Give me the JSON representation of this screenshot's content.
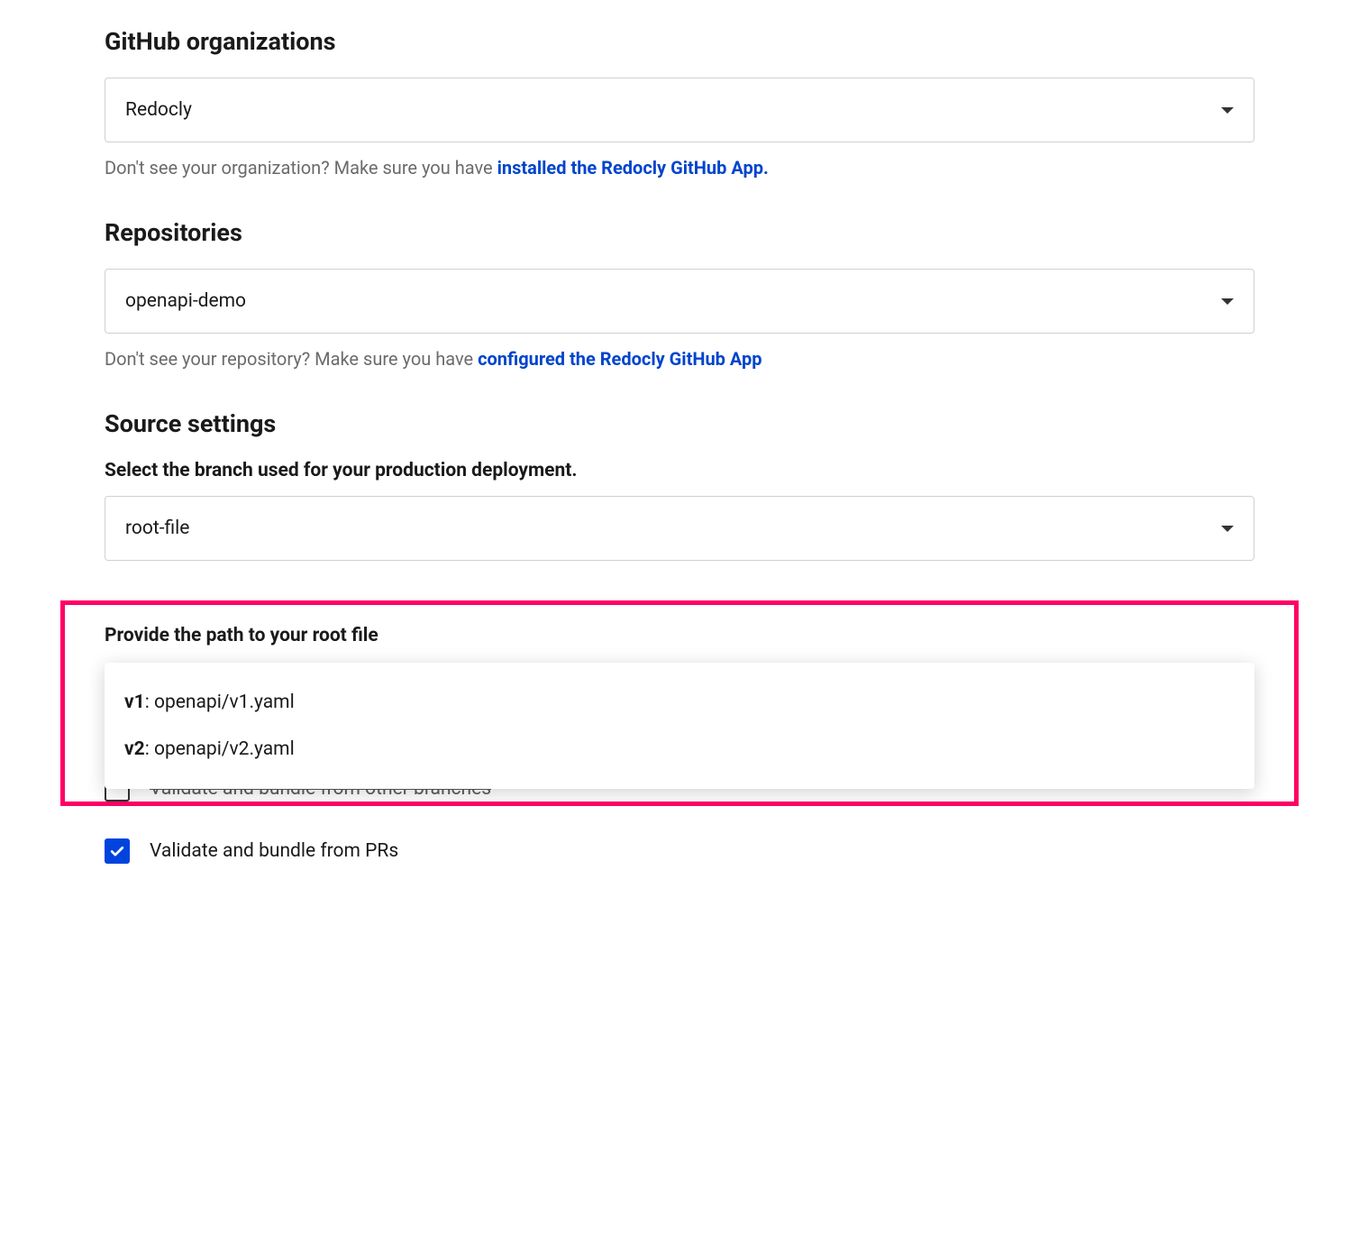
{
  "org": {
    "heading": "GitHub organizations",
    "selected": "Redocly",
    "helper_prefix": "Don't see your organization? Make sure you have ",
    "helper_link": "installed the Redocly GitHub App."
  },
  "repo": {
    "heading": "Repositories",
    "selected": "openapi-demo",
    "helper_prefix": "Don't see your repository? Make sure you have ",
    "helper_link": "configured the Redocly GitHub App"
  },
  "source": {
    "heading": "Source settings",
    "branch_label": "Select the branch used for your production deployment.",
    "branch_selected": "root-file",
    "root_file_label": "Provide the path to your root file",
    "root_file_options": [
      {
        "key": "v1",
        "path": ": openapi/v1.yaml"
      },
      {
        "key": "v2",
        "path": ": openapi/v2.yaml"
      }
    ],
    "checkbox_other_branches": "Validate and bundle from other branches",
    "checkbox_prs": "Validate and bundle from PRs"
  }
}
